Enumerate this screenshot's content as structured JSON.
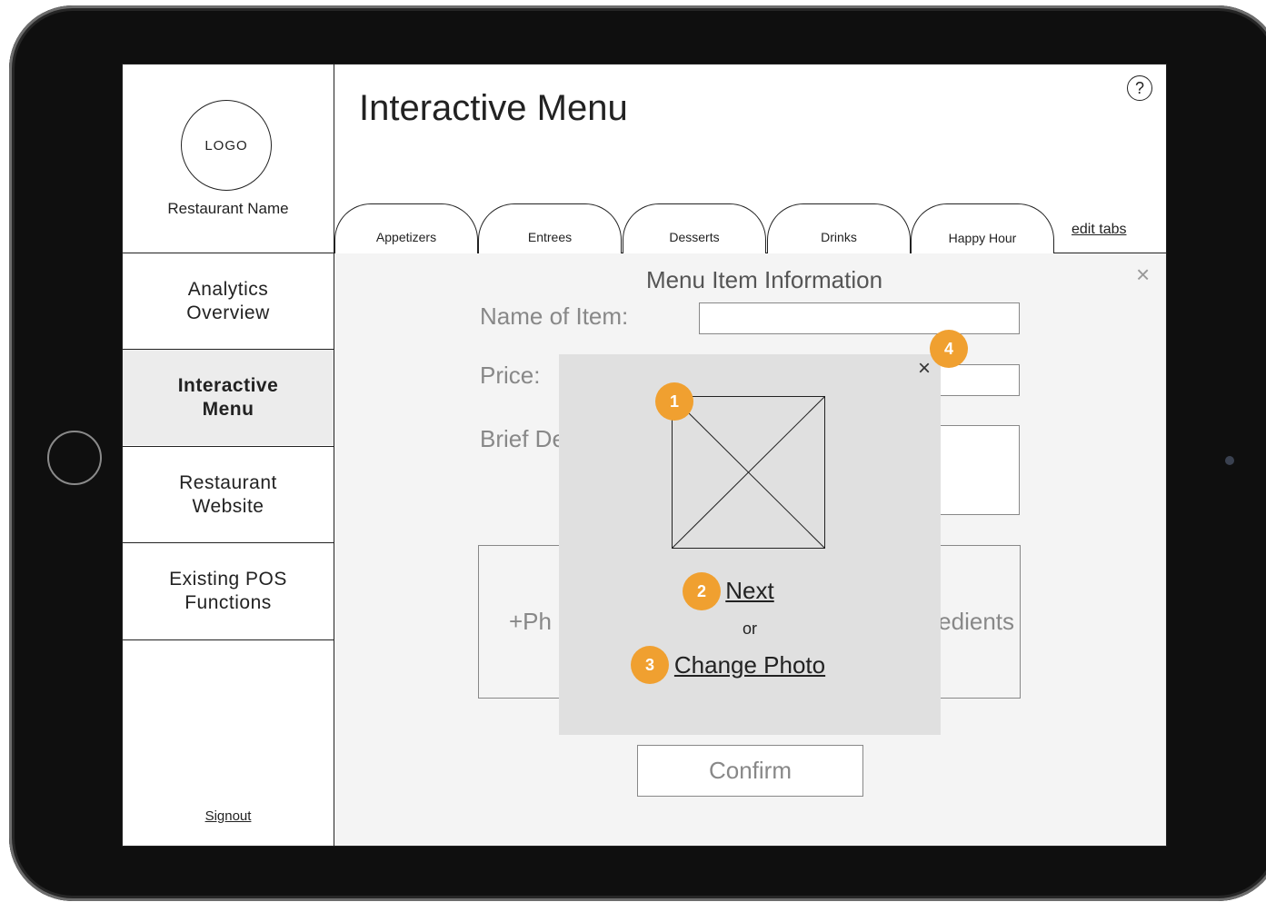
{
  "sidebar": {
    "logo_label": "LOGO",
    "restaurant_name": "Restaurant Name",
    "items": [
      {
        "label": "Analytics Overview"
      },
      {
        "label": "Interactive Menu",
        "active": true
      },
      {
        "label": "Restaurant Website"
      },
      {
        "label": "Existing POS Functions"
      }
    ],
    "signout_label": "Signout"
  },
  "header": {
    "title": "Interactive Menu",
    "help_label": "?",
    "tabs": [
      {
        "label": "Appetizers"
      },
      {
        "label": "Entrees"
      },
      {
        "label": "Desserts"
      },
      {
        "label": "Drinks"
      },
      {
        "label": "Happy Hour",
        "active": true
      }
    ],
    "edit_tabs_label": "edit tabs"
  },
  "form": {
    "heading": "Menu Item Information",
    "close_label": "×",
    "name_label": "Name of Item:",
    "name_value": "",
    "price_label": "Price:",
    "price_value": "",
    "description_label": "Brief De",
    "description_value": "",
    "add_photo_label": "+Ph",
    "ingredients_label": "edients",
    "confirm_label": "Confirm"
  },
  "modal": {
    "close_label": "×",
    "next_label": "Next",
    "or_label": "or",
    "change_photo_label": "Change Photo"
  },
  "annotations": [
    {
      "number": "1"
    },
    {
      "number": "2"
    },
    {
      "number": "3"
    },
    {
      "number": "4"
    }
  ],
  "colors": {
    "annotation_badge": "#f0a030",
    "device_bezel": "#0f0f0f",
    "modal_background": "#e0e0e0",
    "content_background": "#f4f4f4"
  }
}
